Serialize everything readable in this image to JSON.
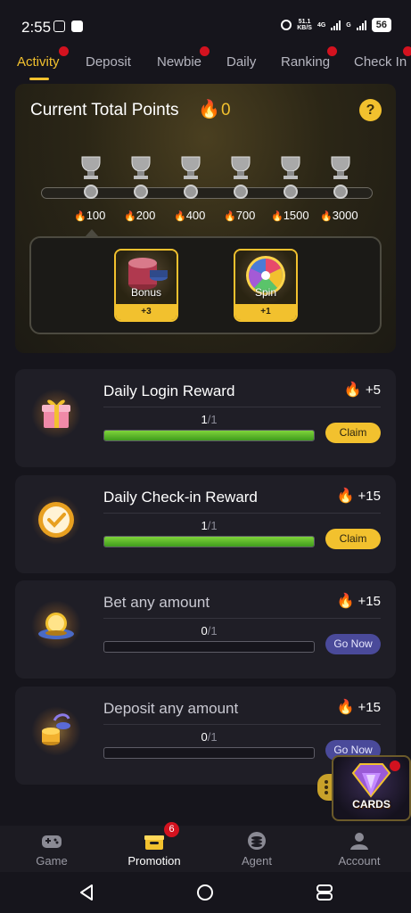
{
  "status_bar": {
    "time": "2:55",
    "net_speed_value": "51.1",
    "net_speed_unit": "KB/S",
    "net_type_1": "4G",
    "net_type_2": "G",
    "battery": "56"
  },
  "tabs": [
    {
      "label": "Activity",
      "active": true,
      "badge": true
    },
    {
      "label": "Deposit",
      "active": false,
      "badge": false
    },
    {
      "label": "Newbie",
      "active": false,
      "badge": true
    },
    {
      "label": "Daily",
      "active": false,
      "badge": false
    },
    {
      "label": "Ranking",
      "active": false,
      "badge": true
    },
    {
      "label": "Check In",
      "active": false,
      "badge": true
    }
  ],
  "points": {
    "title": "Current Total Points",
    "value": "0",
    "help": "?",
    "milestones": [
      "100",
      "200",
      "400",
      "700",
      "1500",
      "3000"
    ],
    "rewards": [
      {
        "label": "Bonus",
        "count": "+3",
        "icon": "chips-icon"
      },
      {
        "label": "Spin",
        "count": "+1",
        "icon": "wheel-icon"
      }
    ]
  },
  "tasks": [
    {
      "title": "Daily Login Reward",
      "reward": "+5",
      "progress": "1",
      "total": "1",
      "fraction": 1.0,
      "button": "Claim",
      "button_type": "claim",
      "icon": "gift-icon"
    },
    {
      "title": "Daily Check-in Reward",
      "reward": "+15",
      "progress": "1",
      "total": "1",
      "fraction": 1.0,
      "button": "Claim",
      "button_type": "claim",
      "icon": "check-badge-icon"
    },
    {
      "title": "Bet any amount",
      "reward": "+15",
      "progress": "0",
      "total": "1",
      "fraction": 0.0,
      "button": "Go Now",
      "button_type": "go",
      "icon": "crystal-ball-icon"
    },
    {
      "title": "Deposit any amount",
      "reward": "+15",
      "progress": "0",
      "total": "1",
      "fraction": 0.0,
      "button": "Go Now",
      "button_type": "go",
      "icon": "coins-icon"
    }
  ],
  "floating_widget": {
    "label": "CARDS"
  },
  "bottom_nav": [
    {
      "label": "Game",
      "icon": "gamepad-icon",
      "active": false
    },
    {
      "label": "Promotion",
      "icon": "gift-box-icon",
      "active": true,
      "badge": "6"
    },
    {
      "label": "Agent",
      "icon": "agent-icon",
      "active": false
    },
    {
      "label": "Account",
      "icon": "account-icon",
      "active": false
    }
  ],
  "colors": {
    "accent": "#f2c12e",
    "progress": "#5fbf2b",
    "go_button": "#4a4a9a",
    "badge": "#d3121f"
  }
}
